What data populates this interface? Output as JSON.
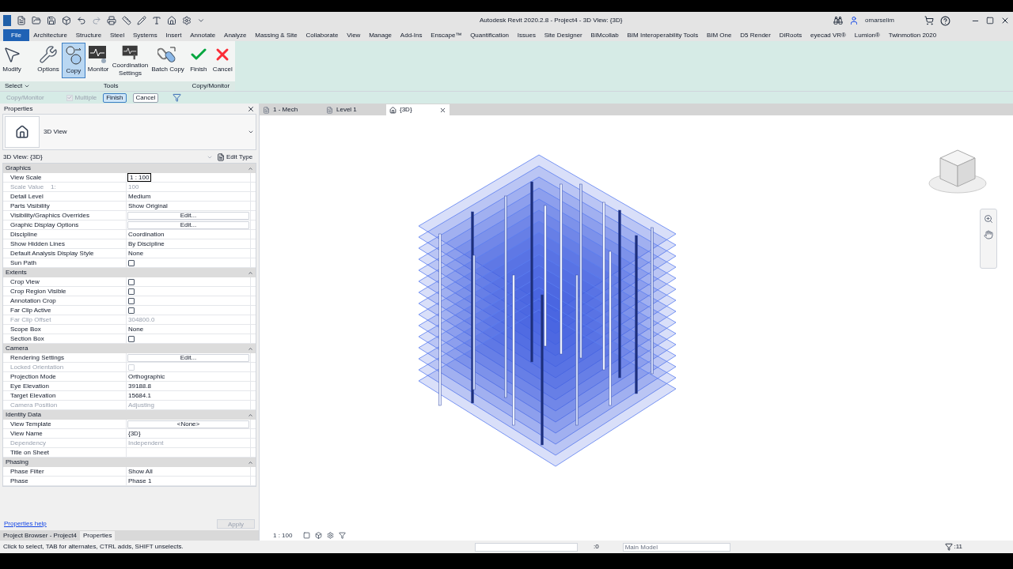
{
  "title_bar": {
    "title": "Autodesk Revit 2020.2.8 - Project4 - 3D View: {3D}",
    "user": "omarselim"
  },
  "ribbon_tabs": [
    {
      "label": "File",
      "selected": false,
      "kind": "file"
    },
    {
      "label": "Architecture",
      "selected": false,
      "kind": "tab"
    },
    {
      "label": "Structure",
      "selected": false,
      "kind": "tab"
    },
    {
      "label": "Steel",
      "selected": false,
      "kind": "tab"
    },
    {
      "label": "Systems",
      "selected": false,
      "kind": "tab"
    },
    {
      "label": "Insert",
      "selected": false,
      "kind": "tab"
    },
    {
      "label": "Annotate",
      "selected": false,
      "kind": "tab"
    },
    {
      "label": "Analyze",
      "selected": false,
      "kind": "tab"
    },
    {
      "label": "Massing & Site",
      "selected": false,
      "kind": "tab"
    },
    {
      "label": "Collaborate",
      "selected": false,
      "kind": "tab"
    },
    {
      "label": "View",
      "selected": false,
      "kind": "tab"
    },
    {
      "label": "Manage",
      "selected": false,
      "kind": "tab"
    },
    {
      "label": "Add-Ins",
      "selected": false,
      "kind": "tab"
    },
    {
      "label": "Enscape™",
      "selected": false,
      "kind": "tab"
    },
    {
      "label": "Quantification",
      "selected": false,
      "kind": "tab"
    },
    {
      "label": "Issues",
      "selected": false,
      "kind": "tab"
    },
    {
      "label": "Site Designer",
      "selected": false,
      "kind": "tab"
    },
    {
      "label": "BIMcollab",
      "selected": false,
      "kind": "tab"
    },
    {
      "label": "BIM Interoperability Tools",
      "selected": false,
      "kind": "tab"
    },
    {
      "label": "BIM One",
      "selected": false,
      "kind": "tab"
    },
    {
      "label": "D5 Render",
      "selected": false,
      "kind": "tab"
    },
    {
      "label": "DiRoots",
      "selected": false,
      "kind": "tab"
    },
    {
      "label": "eyecad VR®",
      "selected": false,
      "kind": "tab"
    },
    {
      "label": "Lumion®",
      "selected": false,
      "kind": "tab"
    },
    {
      "label": "Twinmotion 2020",
      "selected": false,
      "kind": "tab"
    }
  ],
  "ribbon_panels": [
    {
      "label": "Select",
      "dropdown": true,
      "buttons": [
        {
          "label": "Modify",
          "kind": "modify",
          "selected": false
        }
      ]
    },
    {
      "label": "Tools",
      "dropdown": false,
      "buttons": [
        {
          "label": "Options",
          "kind": "options",
          "selected": false
        },
        {
          "label": "Copy",
          "kind": "copy",
          "selected": true
        },
        {
          "label": "Monitor",
          "kind": "monitor",
          "selected": false
        },
        {
          "label": "Coordination Settings",
          "kind": "coord",
          "selected": false
        },
        {
          "label": "Batch Copy",
          "kind": "batch",
          "selected": false
        }
      ]
    },
    {
      "label": "Copy/Monitor",
      "dropdown": false,
      "buttons": [
        {
          "label": "Finish",
          "kind": "finish",
          "selected": false
        },
        {
          "label": "Cancel",
          "kind": "cancel",
          "selected": false
        }
      ]
    }
  ],
  "options_bar": {
    "context": "Copy/Monitor",
    "multiple": {
      "label": "Multiple",
      "checked": true,
      "disabled": true
    },
    "buttons": [
      {
        "label": "Finish",
        "selected": true
      },
      {
        "label": "Cancel",
        "selected": false
      }
    ]
  },
  "properties": {
    "title": "Properties",
    "type_name": "3D View",
    "type_selector": "3D View: {3D}",
    "edit_type": "Edit Type",
    "groups": [
      {
        "name": "Graphics",
        "rows": [
          {
            "label": "View Scale",
            "kind": "field",
            "value": "1 : 100",
            "disabled": false
          },
          {
            "label": "Scale Value    1:",
            "kind": "text",
            "value": "100",
            "disabled": true
          },
          {
            "label": "Detail Level",
            "kind": "text",
            "value": "Medium",
            "disabled": false
          },
          {
            "label": "Parts Visibility",
            "kind": "text",
            "value": "Show Original",
            "disabled": false
          },
          {
            "label": "Visibility/Graphics Overrides",
            "kind": "button",
            "value": "Edit...",
            "disabled": false
          },
          {
            "label": "Graphic Display Options",
            "kind": "button",
            "value": "Edit...",
            "disabled": false
          },
          {
            "label": "Discipline",
            "kind": "text",
            "value": "Coordination",
            "disabled": false
          },
          {
            "label": "Show Hidden Lines",
            "kind": "text",
            "value": "By Discipline",
            "disabled": false
          },
          {
            "label": "Default Analysis Display Style",
            "kind": "text",
            "value": "None",
            "disabled": false
          },
          {
            "label": "Sun Path",
            "kind": "check",
            "checked": false,
            "disabled": false
          }
        ]
      },
      {
        "name": "Extents",
        "rows": [
          {
            "label": "Crop View",
            "kind": "check",
            "checked": false,
            "disabled": false
          },
          {
            "label": "Crop Region Visible",
            "kind": "check",
            "checked": false,
            "disabled": false
          },
          {
            "label": "Annotation Crop",
            "kind": "check",
            "checked": false,
            "disabled": false
          },
          {
            "label": "Far Clip Active",
            "kind": "check",
            "checked": false,
            "disabled": false
          },
          {
            "label": "Far Clip Offset",
            "kind": "text",
            "value": "304800.0",
            "disabled": true
          },
          {
            "label": "Scope Box",
            "kind": "text",
            "value": "None",
            "disabled": false
          },
          {
            "label": "Section Box",
            "kind": "check",
            "checked": false,
            "disabled": false
          }
        ]
      },
      {
        "name": "Camera",
        "rows": [
          {
            "label": "Rendering Settings",
            "kind": "button",
            "value": "Edit...",
            "disabled": false
          },
          {
            "label": "Locked Orientation",
            "kind": "check",
            "checked": false,
            "disabled": true
          },
          {
            "label": "Projection Mode",
            "kind": "text",
            "value": "Orthographic",
            "disabled": false
          },
          {
            "label": "Eye Elevation",
            "kind": "text",
            "value": "39188.8",
            "disabled": false
          },
          {
            "label": "Target Elevation",
            "kind": "text",
            "value": "15684.1",
            "disabled": false
          },
          {
            "label": "Camera Position",
            "kind": "text",
            "value": "Adjusting",
            "disabled": true
          }
        ]
      },
      {
        "name": "Identity Data",
        "rows": [
          {
            "label": "View Template",
            "kind": "button",
            "value": "<None>",
            "disabled": false
          },
          {
            "label": "View Name",
            "kind": "text",
            "value": "{3D}",
            "disabled": false
          },
          {
            "label": "Dependency",
            "kind": "text",
            "value": "Independent",
            "disabled": true
          },
          {
            "label": "Title on Sheet",
            "kind": "text",
            "value": "",
            "disabled": false
          }
        ]
      },
      {
        "name": "Phasing",
        "rows": [
          {
            "label": "Phase Filter",
            "kind": "text",
            "value": "Show All",
            "disabled": false
          },
          {
            "label": "Phase",
            "kind": "text",
            "value": "Phase 1",
            "disabled": false
          }
        ]
      }
    ],
    "help_link": "Properties help",
    "apply": "Apply"
  },
  "panel_tabs": [
    {
      "label": "Project Browser - Project4",
      "selected": false
    },
    {
      "label": "Properties",
      "selected": true
    }
  ],
  "view_tabs": [
    {
      "label": "1 - Mech",
      "kind": "plan",
      "selected": false
    },
    {
      "label": "Level 1",
      "kind": "plan",
      "selected": false
    },
    {
      "label": "{3D}",
      "kind": "model",
      "selected": true
    }
  ],
  "view_control": {
    "scale": "1 : 100"
  },
  "status_bar": {
    "message": "Click to select, TAB for alternates, CTRL adds, SHIFT unselects.",
    "design_count": ":0",
    "workset": "Main Model",
    "filter_count": ":11"
  }
}
